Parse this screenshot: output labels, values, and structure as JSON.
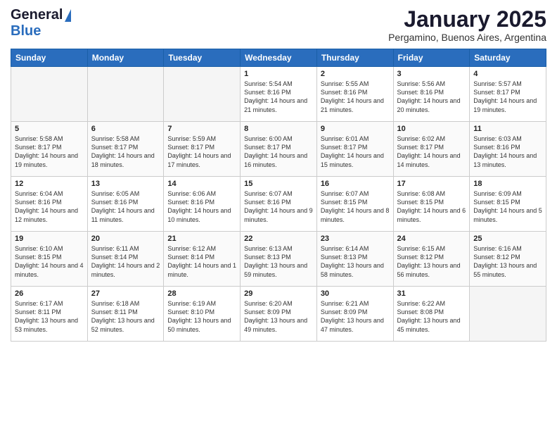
{
  "logo": {
    "line1": "General",
    "line2": "Blue"
  },
  "header": {
    "month": "January 2025",
    "location": "Pergamino, Buenos Aires, Argentina"
  },
  "weekdays": [
    "Sunday",
    "Monday",
    "Tuesday",
    "Wednesday",
    "Thursday",
    "Friday",
    "Saturday"
  ],
  "weeks": [
    [
      {
        "day": "",
        "sunrise": "",
        "sunset": "",
        "daylight": ""
      },
      {
        "day": "",
        "sunrise": "",
        "sunset": "",
        "daylight": ""
      },
      {
        "day": "",
        "sunrise": "",
        "sunset": "",
        "daylight": ""
      },
      {
        "day": "1",
        "sunrise": "Sunrise: 5:54 AM",
        "sunset": "Sunset: 8:16 PM",
        "daylight": "Daylight: 14 hours and 21 minutes."
      },
      {
        "day": "2",
        "sunrise": "Sunrise: 5:55 AM",
        "sunset": "Sunset: 8:16 PM",
        "daylight": "Daylight: 14 hours and 21 minutes."
      },
      {
        "day": "3",
        "sunrise": "Sunrise: 5:56 AM",
        "sunset": "Sunset: 8:16 PM",
        "daylight": "Daylight: 14 hours and 20 minutes."
      },
      {
        "day": "4",
        "sunrise": "Sunrise: 5:57 AM",
        "sunset": "Sunset: 8:17 PM",
        "daylight": "Daylight: 14 hours and 19 minutes."
      }
    ],
    [
      {
        "day": "5",
        "sunrise": "Sunrise: 5:58 AM",
        "sunset": "Sunset: 8:17 PM",
        "daylight": "Daylight: 14 hours and 19 minutes."
      },
      {
        "day": "6",
        "sunrise": "Sunrise: 5:58 AM",
        "sunset": "Sunset: 8:17 PM",
        "daylight": "Daylight: 14 hours and 18 minutes."
      },
      {
        "day": "7",
        "sunrise": "Sunrise: 5:59 AM",
        "sunset": "Sunset: 8:17 PM",
        "daylight": "Daylight: 14 hours and 17 minutes."
      },
      {
        "day": "8",
        "sunrise": "Sunrise: 6:00 AM",
        "sunset": "Sunset: 8:17 PM",
        "daylight": "Daylight: 14 hours and 16 minutes."
      },
      {
        "day": "9",
        "sunrise": "Sunrise: 6:01 AM",
        "sunset": "Sunset: 8:17 PM",
        "daylight": "Daylight: 14 hours and 15 minutes."
      },
      {
        "day": "10",
        "sunrise": "Sunrise: 6:02 AM",
        "sunset": "Sunset: 8:17 PM",
        "daylight": "Daylight: 14 hours and 14 minutes."
      },
      {
        "day": "11",
        "sunrise": "Sunrise: 6:03 AM",
        "sunset": "Sunset: 8:16 PM",
        "daylight": "Daylight: 14 hours and 13 minutes."
      }
    ],
    [
      {
        "day": "12",
        "sunrise": "Sunrise: 6:04 AM",
        "sunset": "Sunset: 8:16 PM",
        "daylight": "Daylight: 14 hours and 12 minutes."
      },
      {
        "day": "13",
        "sunrise": "Sunrise: 6:05 AM",
        "sunset": "Sunset: 8:16 PM",
        "daylight": "Daylight: 14 hours and 11 minutes."
      },
      {
        "day": "14",
        "sunrise": "Sunrise: 6:06 AM",
        "sunset": "Sunset: 8:16 PM",
        "daylight": "Daylight: 14 hours and 10 minutes."
      },
      {
        "day": "15",
        "sunrise": "Sunrise: 6:07 AM",
        "sunset": "Sunset: 8:16 PM",
        "daylight": "Daylight: 14 hours and 9 minutes."
      },
      {
        "day": "16",
        "sunrise": "Sunrise: 6:07 AM",
        "sunset": "Sunset: 8:15 PM",
        "daylight": "Daylight: 14 hours and 8 minutes."
      },
      {
        "day": "17",
        "sunrise": "Sunrise: 6:08 AM",
        "sunset": "Sunset: 8:15 PM",
        "daylight": "Daylight: 14 hours and 6 minutes."
      },
      {
        "day": "18",
        "sunrise": "Sunrise: 6:09 AM",
        "sunset": "Sunset: 8:15 PM",
        "daylight": "Daylight: 14 hours and 5 minutes."
      }
    ],
    [
      {
        "day": "19",
        "sunrise": "Sunrise: 6:10 AM",
        "sunset": "Sunset: 8:15 PM",
        "daylight": "Daylight: 14 hours and 4 minutes."
      },
      {
        "day": "20",
        "sunrise": "Sunrise: 6:11 AM",
        "sunset": "Sunset: 8:14 PM",
        "daylight": "Daylight: 14 hours and 2 minutes."
      },
      {
        "day": "21",
        "sunrise": "Sunrise: 6:12 AM",
        "sunset": "Sunset: 8:14 PM",
        "daylight": "Daylight: 14 hours and 1 minute."
      },
      {
        "day": "22",
        "sunrise": "Sunrise: 6:13 AM",
        "sunset": "Sunset: 8:13 PM",
        "daylight": "Daylight: 13 hours and 59 minutes."
      },
      {
        "day": "23",
        "sunrise": "Sunrise: 6:14 AM",
        "sunset": "Sunset: 8:13 PM",
        "daylight": "Daylight: 13 hours and 58 minutes."
      },
      {
        "day": "24",
        "sunrise": "Sunrise: 6:15 AM",
        "sunset": "Sunset: 8:12 PM",
        "daylight": "Daylight: 13 hours and 56 minutes."
      },
      {
        "day": "25",
        "sunrise": "Sunrise: 6:16 AM",
        "sunset": "Sunset: 8:12 PM",
        "daylight": "Daylight: 13 hours and 55 minutes."
      }
    ],
    [
      {
        "day": "26",
        "sunrise": "Sunrise: 6:17 AM",
        "sunset": "Sunset: 8:11 PM",
        "daylight": "Daylight: 13 hours and 53 minutes."
      },
      {
        "day": "27",
        "sunrise": "Sunrise: 6:18 AM",
        "sunset": "Sunset: 8:11 PM",
        "daylight": "Daylight: 13 hours and 52 minutes."
      },
      {
        "day": "28",
        "sunrise": "Sunrise: 6:19 AM",
        "sunset": "Sunset: 8:10 PM",
        "daylight": "Daylight: 13 hours and 50 minutes."
      },
      {
        "day": "29",
        "sunrise": "Sunrise: 6:20 AM",
        "sunset": "Sunset: 8:09 PM",
        "daylight": "Daylight: 13 hours and 49 minutes."
      },
      {
        "day": "30",
        "sunrise": "Sunrise: 6:21 AM",
        "sunset": "Sunset: 8:09 PM",
        "daylight": "Daylight: 13 hours and 47 minutes."
      },
      {
        "day": "31",
        "sunrise": "Sunrise: 6:22 AM",
        "sunset": "Sunset: 8:08 PM",
        "daylight": "Daylight: 13 hours and 45 minutes."
      },
      {
        "day": "",
        "sunrise": "",
        "sunset": "",
        "daylight": ""
      }
    ]
  ]
}
